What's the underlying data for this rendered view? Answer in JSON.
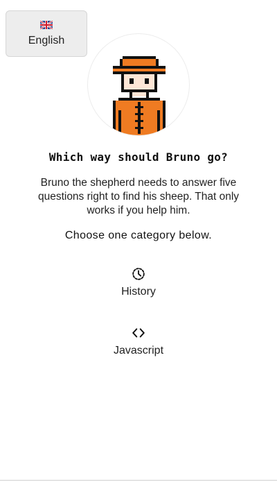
{
  "language": {
    "label": "English",
    "icon": "uk-flag-icon"
  },
  "avatar": {
    "icon": "pixel-shepherd-icon",
    "colors": {
      "hat": "#ef7b22",
      "coat": "#ef7b22",
      "skin": "#fde6d6",
      "outline": "#111111"
    }
  },
  "title": "Which way should Bruno go?",
  "intro": "Bruno the shepherd needs to answer five questions right to find his sheep. That only works if you help him.",
  "instruction": "Choose one category below.",
  "categories": [
    {
      "label": "History",
      "icon": "history-clock-icon"
    },
    {
      "label": "Javascript",
      "icon": "code-brackets-icon"
    }
  ]
}
